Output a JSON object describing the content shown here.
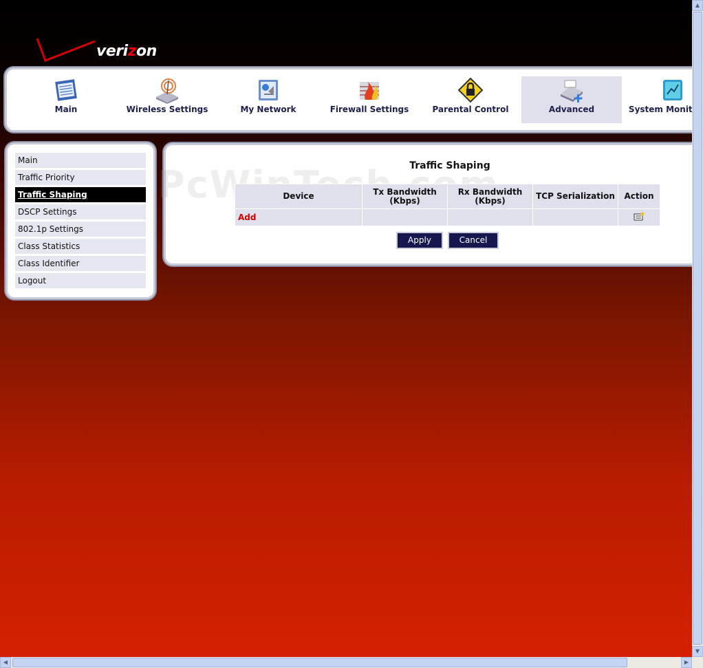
{
  "brand": {
    "name_part1": "veri",
    "name_z": "z",
    "name_part2": "on"
  },
  "top_nav": [
    {
      "label": "Main",
      "icon": "main-icon"
    },
    {
      "label": "Wireless Settings",
      "icon": "wireless-icon"
    },
    {
      "label": "My Network",
      "icon": "network-icon"
    },
    {
      "label": "Firewall Settings",
      "icon": "firewall-icon"
    },
    {
      "label": "Parental Control",
      "icon": "lock-icon"
    },
    {
      "label": "Advanced",
      "icon": "advanced-icon",
      "active": true
    },
    {
      "label": "System Monitoring",
      "icon": "monitor-icon"
    }
  ],
  "side_nav": [
    {
      "label": "Main"
    },
    {
      "label": "Traffic Priority"
    },
    {
      "label": "Traffic Shaping",
      "active": true
    },
    {
      "label": "DSCP Settings"
    },
    {
      "label": "802.1p Settings"
    },
    {
      "label": "Class Statistics"
    },
    {
      "label": "Class Identifier"
    },
    {
      "label": "Logout"
    }
  ],
  "content": {
    "title": "Traffic Shaping",
    "watermark": "PcWinTech.com",
    "table": {
      "headers": [
        "Device",
        "Tx Bandwidth (Kbps)",
        "Rx Bandwidth (Kbps)",
        "TCP Serialization",
        "Action"
      ],
      "add_label": "Add"
    },
    "apply_label": "Apply",
    "cancel_label": "Cancel"
  },
  "colors": {
    "accent": "#16174e",
    "nav_text": "#202050",
    "active_side": "#000000",
    "add_text": "#d00000"
  }
}
